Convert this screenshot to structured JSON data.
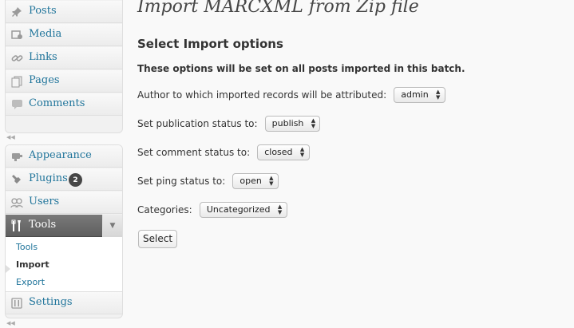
{
  "sidebar": {
    "group1": [
      {
        "label": "Posts",
        "icon": "pushpin-icon"
      },
      {
        "label": "Media",
        "icon": "media-icon"
      },
      {
        "label": "Links",
        "icon": "link-icon"
      },
      {
        "label": "Pages",
        "icon": "pages-icon"
      },
      {
        "label": "Comments",
        "icon": "comments-icon"
      }
    ],
    "group2": [
      {
        "label": "Appearance",
        "icon": "appearance-icon"
      },
      {
        "label": "Plugins",
        "icon": "plugins-icon",
        "badge": "2"
      },
      {
        "label": "Users",
        "icon": "users-icon"
      },
      {
        "label": "Tools",
        "icon": "tools-icon"
      },
      {
        "label": "Settings",
        "icon": "settings-icon"
      }
    ],
    "tools_submenu": [
      "Tools",
      "Import",
      "Export"
    ],
    "current_submenu": "Import"
  },
  "main": {
    "title": "Import MARCXML from Zip file",
    "section_title": "Select Import options",
    "note": "These options will be set on all posts imported in this batch.",
    "options": [
      {
        "label": "Author to which imported records will be attributed:",
        "value": "admin"
      },
      {
        "label": "Set publication status to:",
        "value": "publish"
      },
      {
        "label": "Set comment status to:",
        "value": "closed"
      },
      {
        "label": "Set ping status to:",
        "value": "open"
      },
      {
        "label": "Categories:",
        "value": "Uncategorized"
      }
    ],
    "submit_label": "Select"
  },
  "colors": {
    "link": "#21759b",
    "active_menu": "#6d6d6d",
    "badge": "#464646"
  }
}
